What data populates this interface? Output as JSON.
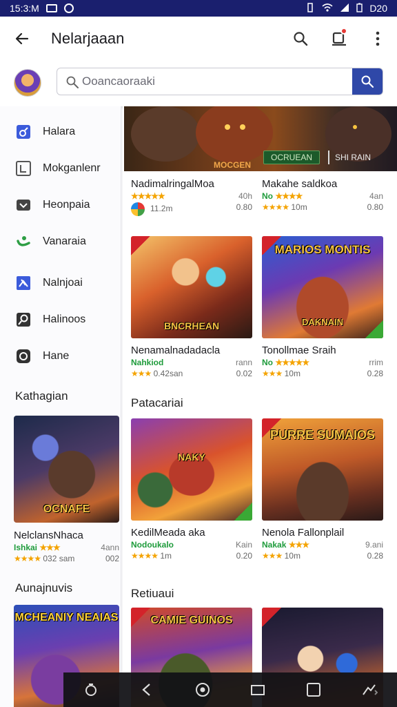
{
  "status_bar": {
    "time": "15:3:M",
    "right_text": "D20"
  },
  "app_bar": {
    "title": "Nelarjaaan",
    "icons": [
      "back-arrow-icon",
      "search-icon",
      "notification-icon",
      "more-vert-icon"
    ]
  },
  "search": {
    "placeholder": "Ooancaoraaki"
  },
  "sidebar": {
    "items": [
      {
        "label": "Halara",
        "icon": "controller-icon"
      },
      {
        "label": "Mokganlenr",
        "icon": "grid-icon"
      },
      {
        "label": "Heonpaia",
        "icon": "heart-icon"
      },
      {
        "label": "Vanaraia",
        "icon": "leaf-icon"
      },
      {
        "label": "Nalnjoai",
        "icon": "puzzle-icon"
      },
      {
        "label": "Halinoos",
        "icon": "magnifier-icon"
      },
      {
        "label": "Hane",
        "icon": "circle-icon"
      }
    ],
    "section1": "Kathagian",
    "section2": "Aunajnuvis",
    "card": {
      "thumb_text": "OCNAFE",
      "title": "NelclansNhaca",
      "sub": "Ishkai",
      "rating_text": "032 sam",
      "rating_right": "002",
      "size_right": "4ann"
    },
    "card2_thumb_text": "MCHEANIY NEAIAS"
  },
  "hero": {
    "button1": "OCRUEAN",
    "button2": "SHI RAIN",
    "overlay_text": "MOCGEN"
  },
  "main": {
    "row1": [
      {
        "title": "NadimalringalMoa",
        "meta_left": "11.2m",
        "meta_right": "0.80",
        "sub_right": "40h"
      },
      {
        "title": "Makahe saldkoa",
        "sub": "No",
        "meta_left": "10m",
        "meta_right": "0.80",
        "sub_right": "4an"
      }
    ],
    "row2": [
      {
        "thumb_text": "BNCRHEAN",
        "title": "Nenamalnadadacla",
        "sub": "Nahkiod",
        "sub_right": "rann",
        "meta_left": "0.42san",
        "meta_right": "0.02"
      },
      {
        "thumb_text": "MARIOS MONTIS",
        "thumb_text2": "DAKNAIN",
        "title": "Tonollmae Sraih",
        "sub": "No",
        "sub_right": "rrim",
        "meta_left": "10m",
        "meta_right": "0.28"
      }
    ],
    "section_a": "Patacariai",
    "row3": [
      {
        "thumb_text": "NAKY",
        "title": "KedilMeada aka",
        "sub": "Nodoukalo",
        "sub_right": "Kain",
        "meta_left": "1m",
        "meta_right": "0.20"
      },
      {
        "thumb_text": "PURRE SUMAIOS",
        "title": "Nenola Fallonplail",
        "sub": "Nakak",
        "sub_right": "9.ani",
        "meta_left": "10m",
        "meta_right": "0.28"
      }
    ],
    "section_b": "Retiuaui",
    "row4": [
      {
        "thumb_text": "CAMIE GUINOS"
      },
      {
        "thumb_text": ""
      }
    ]
  },
  "colors": {
    "status_bar": "#1a1f6e",
    "accent": "#2f48a8",
    "rating_green": "#1e9b3b",
    "star": "#f4a300"
  }
}
